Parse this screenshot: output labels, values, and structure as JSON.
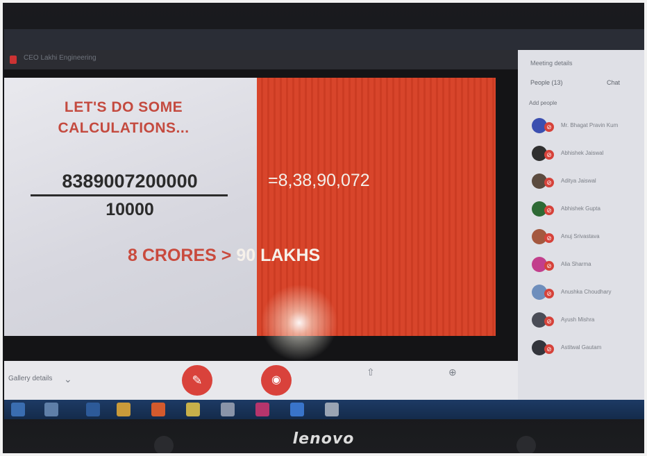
{
  "window": {
    "title": "CEO Lakhi Engineering"
  },
  "slide": {
    "heading_line1": "LET'S DO SOME",
    "heading_line2": "CALCULATIONS...",
    "numerator": "8389007200000",
    "denominator": "10000",
    "result": "=8,38,90,072",
    "conclusion_left": "8 CRORES >",
    "conclusion_right": "90 LAKHS"
  },
  "controls": {
    "layout_label": "Gallery details",
    "mic_icon": "mic-off-icon",
    "camera_icon": "camera-off-icon"
  },
  "panel": {
    "title": "Meeting details",
    "tab_people": "People (13)",
    "tab_chat": "Chat",
    "add_people": "Add people",
    "participants": [
      {
        "name": "Mr. Bhagat Pravin Kum",
        "color": "#3b4fb0"
      },
      {
        "name": "Abhishek Jaiswal",
        "color": "#2f2f2f"
      },
      {
        "name": "Aditya Jaiswal",
        "color": "#5b4b3f"
      },
      {
        "name": "Abhishek Gupta",
        "color": "#2e6a35"
      },
      {
        "name": "Anuj Srivastava",
        "color": "#a4583f"
      },
      {
        "name": "Alia Sharma",
        "color": "#c23f8c"
      },
      {
        "name": "Anushka Choudhary",
        "color": "#6e8ebc"
      },
      {
        "name": "Ayush Mishra",
        "color": "#4a4c56"
      },
      {
        "name": "Astitwal Gautam",
        "color": "#33353c"
      }
    ]
  },
  "device": {
    "brand": "lenovo"
  }
}
